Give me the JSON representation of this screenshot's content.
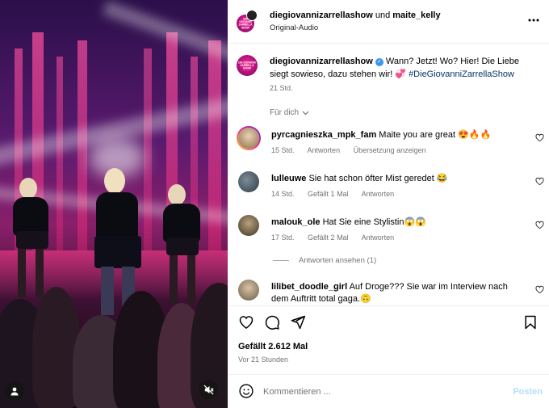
{
  "header": {
    "account": "diegiovannizarrellashow",
    "joiner": "und",
    "collaborator": "maite_kelly",
    "audio": "Original-Audio"
  },
  "caption": {
    "username": "diegiovannizarrellashow",
    "text": "Wann? Jetzt! Wo? Hier! Die Liebe siegt sowieso, dazu stehen wir! 💞",
    "hashtag": "#DieGiovanniZarrellaShow",
    "time": "21 Std."
  },
  "sort_label": "Für dich",
  "comments": [
    {
      "username": "pyrcagnieszka_mpk_fam",
      "text": "Maite you are great 😍🔥🔥",
      "time": "15 Std.",
      "likes": "",
      "reply": "Antworten",
      "translate": "Übersetzung anzeigen"
    },
    {
      "username": "lulleuwe",
      "text": "Sie hat schon öfter Mist geredet 😂",
      "time": "14 Std.",
      "likes": "Gefällt 1 Mal",
      "reply": "Antworten",
      "translate": ""
    },
    {
      "username": "malouk_ole",
      "text": "Hat Sie eine Stylistin😱😱",
      "time": "17 Std.",
      "likes": "Gefällt 2 Mal",
      "reply": "Antworten",
      "translate": ""
    },
    {
      "username": "lilibet_doodle_girl",
      "text": "Auf Droge??? Sie war im Interview nach dem Auftritt total gaga.🙃",
      "time": "",
      "likes": "",
      "reply": "",
      "translate": ""
    }
  ],
  "view_replies": "Antworten ansehen (1)",
  "likes_total": "Gefällt 2.612 Mal",
  "post_time": "Vor 21 Stunden",
  "composer": {
    "placeholder": "Kommentieren ...",
    "post_label": "Posten"
  },
  "avatar_text": "DIE GIOVANNI ZARRELLA SHOW",
  "icons": {
    "like": "heart-icon",
    "comment": "comment-icon",
    "share": "paper-plane-icon",
    "save": "bookmark-icon",
    "more": "more-icon",
    "emoji": "emoji-icon",
    "mute": "mute-icon",
    "user": "user-tag-icon"
  }
}
